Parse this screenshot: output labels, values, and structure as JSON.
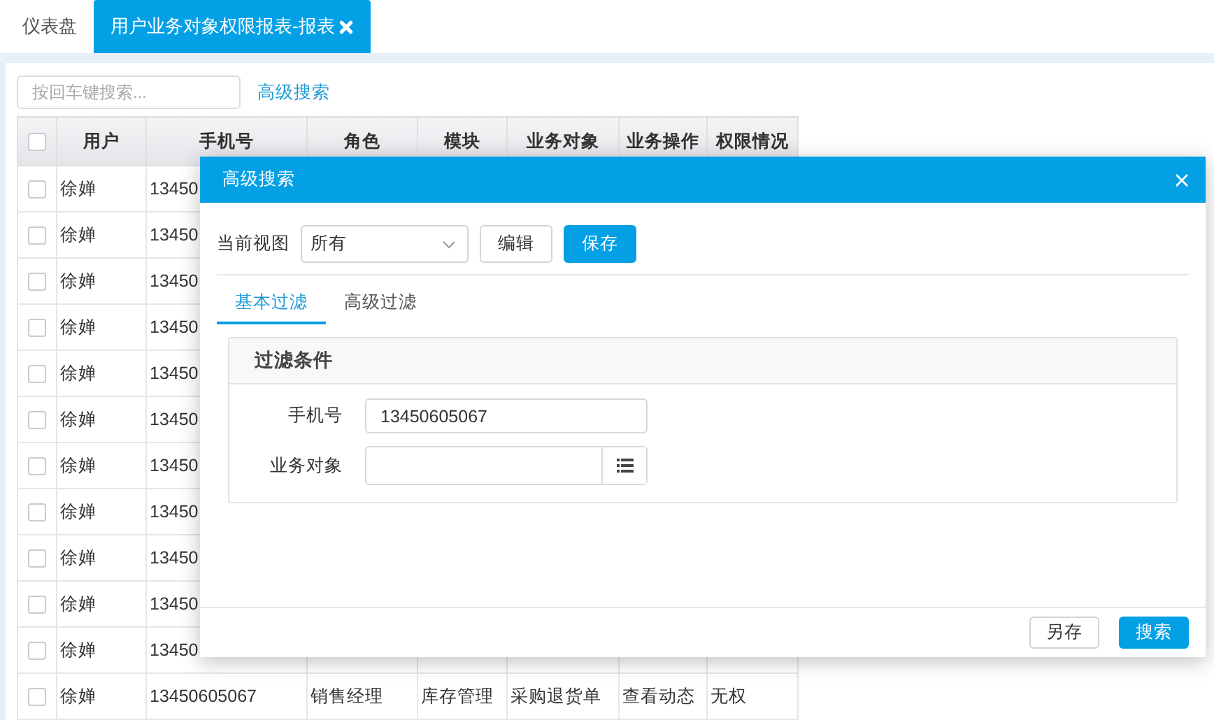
{
  "tabs": [
    {
      "label": "仪表盘",
      "selected": false,
      "closable": false
    },
    {
      "label": "用户业务对象权限报表-报表",
      "selected": true,
      "closable": true
    }
  ],
  "toolbar": {
    "search": {
      "placeholder": "按回车键搜索..."
    },
    "advanced_link": "高级搜索"
  },
  "table": {
    "select_all": {
      "checked": false
    },
    "columns": [
      "用户",
      "手机号",
      "角色",
      "模块",
      "业务对象",
      "业务操作",
      "权限情况"
    ],
    "rows": [
      {
        "checked": false,
        "cells": [
          "徐婵",
          "13450"
        ]
      },
      {
        "checked": false,
        "cells": [
          "徐婵",
          "13450"
        ]
      },
      {
        "checked": false,
        "cells": [
          "徐婵",
          "13450"
        ]
      },
      {
        "checked": false,
        "cells": [
          "徐婵",
          "13450"
        ]
      },
      {
        "checked": false,
        "cells": [
          "徐婵",
          "13450"
        ]
      },
      {
        "checked": false,
        "cells": [
          "徐婵",
          "13450"
        ]
      },
      {
        "checked": false,
        "cells": [
          "徐婵",
          "13450"
        ]
      },
      {
        "checked": false,
        "cells": [
          "徐婵",
          "13450"
        ]
      },
      {
        "checked": false,
        "cells": [
          "徐婵",
          "13450"
        ]
      },
      {
        "checked": false,
        "cells": [
          "徐婵",
          "13450"
        ]
      },
      {
        "checked": false,
        "cells": [
          "徐婵",
          "13450"
        ]
      },
      {
        "checked": false,
        "cells": [
          "徐婵",
          "13450605067",
          "销售经理",
          "库存管理",
          "采购退货单",
          "查看动态",
          "无权"
        ]
      }
    ]
  },
  "dialog": {
    "title": "高级搜索",
    "view_label": "当前视图",
    "view_value": "所有",
    "buttons": [
      {
        "label": "编辑",
        "kind": "default"
      },
      {
        "label": "保存",
        "kind": "primary"
      }
    ],
    "tabs": [
      {
        "label": "基本过滤",
        "selected": true
      },
      {
        "label": "高级过滤",
        "selected": false
      }
    ],
    "panel_title": "过滤条件",
    "fields": [
      {
        "label": "手机号",
        "kind": "text",
        "value": "13450605067"
      },
      {
        "label": "业务对象",
        "kind": "picker"
      }
    ],
    "footer_buttons": [
      {
        "label": "另存",
        "kind": "default"
      },
      {
        "label": "搜索",
        "kind": "primary"
      }
    ]
  }
}
